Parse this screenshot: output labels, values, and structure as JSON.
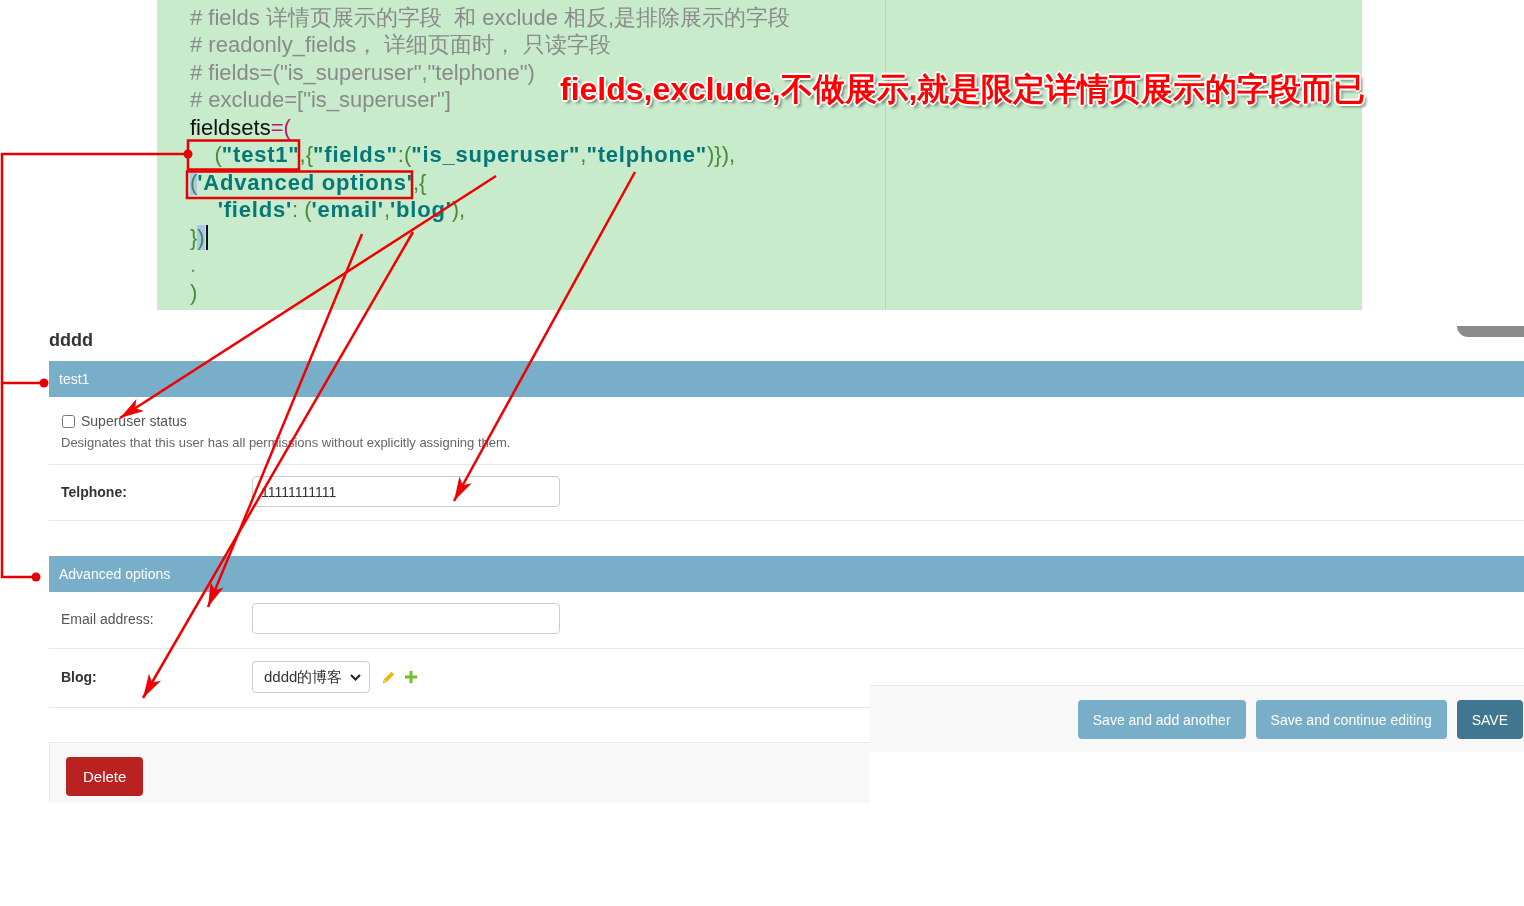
{
  "code_editor": {
    "lines": [
      {
        "tokens": [
          {
            "text": "# fields 详情页展示的字段  和 exclude 相反,是排除展示的字段",
            "kind": "comment"
          }
        ],
        "cursor": false
      },
      {
        "tokens": [
          {
            "text": "# readonly_fields， 详细页面时， 只读字段",
            "kind": "comment"
          }
        ],
        "cursor": false
      },
      {
        "tokens": [
          {
            "text": "# fields=(\"is_superuser\",\"telphone\")",
            "kind": "comment"
          }
        ],
        "cursor": false
      },
      {
        "tokens": [
          {
            "text": "# exclude=[\"is_superuser\"]",
            "kind": "comment"
          }
        ],
        "cursor": false
      },
      {
        "tokens": [
          {
            "text": "fieldsets",
            "kind": "name"
          },
          {
            "text": "=(",
            "kind": "operator"
          }
        ],
        "cursor": false
      },
      {
        "tokens": [
          {
            "text": "    (",
            "kind": "punct"
          },
          {
            "text": "\"test1\"",
            "kind": "string"
          },
          {
            "text": ",{",
            "kind": "punct"
          },
          {
            "text": "\"fields\"",
            "kind": "string"
          },
          {
            "text": ":(",
            "kind": "punct"
          },
          {
            "text": "\"is_superuser\"",
            "kind": "string"
          },
          {
            "text": ",",
            "kind": "punct"
          },
          {
            "text": "\"telphone\"",
            "kind": "string"
          },
          {
            "text": ")}),",
            "kind": "punct"
          }
        ],
        "cursor": false
      },
      {
        "tokens": [
          {
            "text": "(",
            "kind": "match"
          },
          {
            "text": "'Advanced options'",
            "kind": "string"
          },
          {
            "text": ",{",
            "kind": "punct"
          }
        ],
        "cursor": false
      },
      {
        "tokens": [
          {
            "text": "    'fields'",
            "kind": "string"
          },
          {
            "text": ": (",
            "kind": "punct"
          },
          {
            "text": "'email'",
            "kind": "string"
          },
          {
            "text": ",",
            "kind": "punct"
          },
          {
            "text": "'blog'",
            "kind": "string"
          },
          {
            "text": "),",
            "kind": "punct"
          }
        ],
        "cursor": false
      },
      {
        "tokens": [
          {
            "text": "}",
            "kind": "punct"
          },
          {
            "text": ")",
            "kind": "match"
          }
        ],
        "cursor": true
      },
      {
        "tokens": [
          {
            "text": ".",
            "kind": "faint"
          }
        ],
        "cursor": false
      },
      {
        "tokens": [
          {
            "text": ")",
            "kind": "punct"
          }
        ],
        "cursor": false
      }
    ]
  },
  "annotation": {
    "text": "fields,exclude,不做展示,就是限定详情页展示的字段而已"
  },
  "form": {
    "title": "dddd",
    "fieldsets": [
      {
        "title": "test1",
        "fields": [
          {
            "kind": "checkbox",
            "label": "Superuser status",
            "checked": false,
            "help": "Designates that this user has all permissions without explicitly assigning them."
          },
          {
            "kind": "text",
            "label": "Telphone:",
            "required": true,
            "value": "11111111111"
          }
        ]
      },
      {
        "title": "Advanced options",
        "fields": [
          {
            "kind": "text",
            "label": "Email address:",
            "required": false
          },
          {
            "kind": "select",
            "label": "Blog:",
            "required": true,
            "value": "dddd的博客"
          }
        ]
      }
    ],
    "delete_button": "Delete",
    "submit_buttons": [
      {
        "label": "Save and add another",
        "kind": "secondary"
      },
      {
        "label": "Save and continue editing",
        "kind": "secondary"
      },
      {
        "label": "SAVE",
        "kind": "default"
      }
    ]
  }
}
